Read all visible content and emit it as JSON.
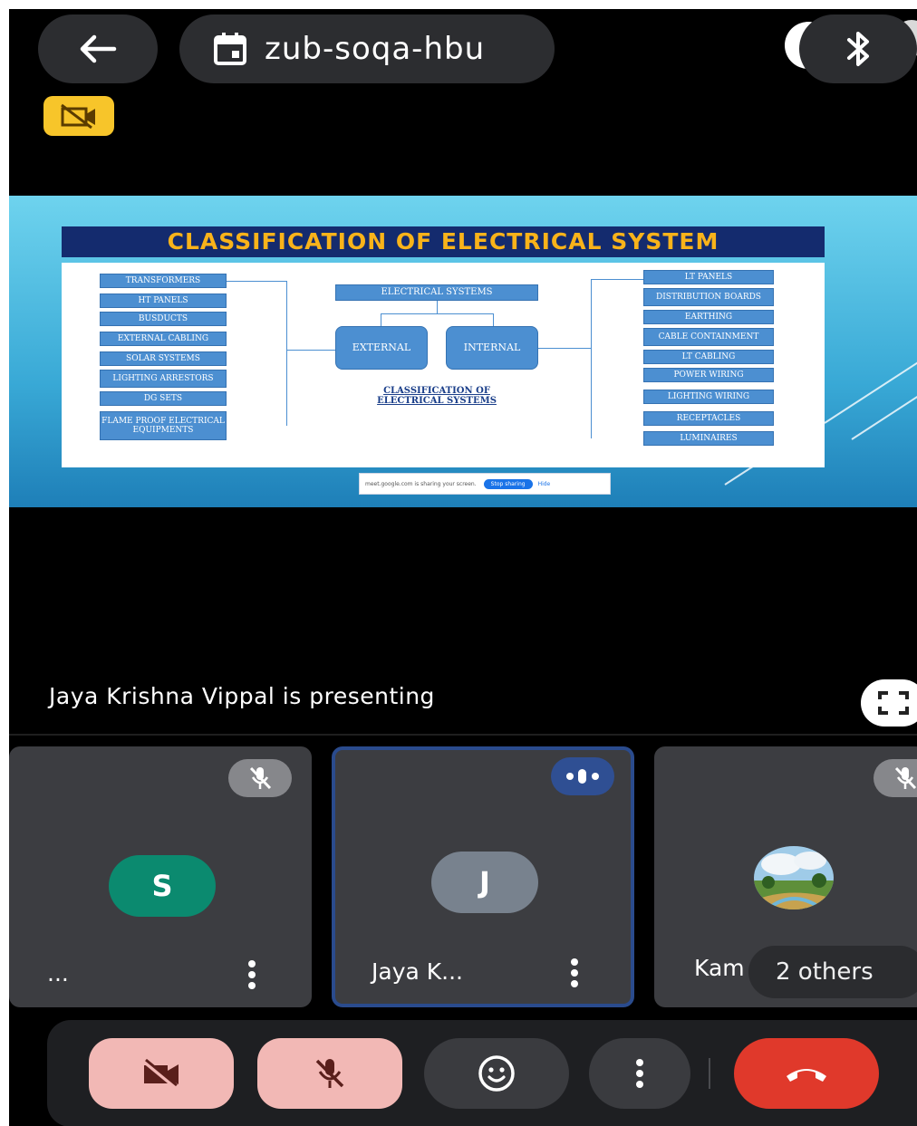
{
  "meeting": {
    "code": "zub-soqa-hbu",
    "presenting_text": "Jaya Krishna Vippal is presenting"
  },
  "slide": {
    "title": "CLASSIFICATION OF ELECTRICAL SYSTEM",
    "center_top": "ELECTRICAL SYSTEMS",
    "external": "EXTERNAL",
    "internal": "INTERNAL",
    "caption_line1": "CLASSIFICATION OF",
    "caption_line2": "ELECTRICAL SYSTEMS",
    "left_items": [
      "TRANSFORMERS",
      "HT PANELS",
      "BUSDUCTS",
      "EXTERNAL CABLING",
      "SOLAR SYSTEMS",
      "LIGHTING ARRESTORS",
      "DG SETS",
      "FLAME PROOF ELECTRICAL EQUIPMENTS"
    ],
    "right_items": [
      "LT PANELS",
      "DISTRIBUTION BOARDS",
      "EARTHING",
      "CABLE CONTAINMENT",
      "LT CABLING",
      "POWER WIRING",
      "LIGHTING WIRING",
      "RECEPTACLES",
      "LUMINAIRES"
    ],
    "share_text": "meet.google.com is sharing your screen.",
    "stop_sharing": "Stop sharing",
    "hide": "Hide"
  },
  "participants": [
    {
      "initial": "S",
      "name": "...",
      "color": "#0b8a6f",
      "status": "muted"
    },
    {
      "initial": "J",
      "name": "Jaya K...",
      "color": "#78828e",
      "status": "speaking"
    },
    {
      "initial": "",
      "name": "Kam",
      "color": "",
      "status": "muted"
    }
  ],
  "others_label": "2 others",
  "colors": {
    "accent_yellow": "#f7c52a",
    "end_call": "#e0392b",
    "muted_control": "#f2b8b5"
  },
  "icons": [
    "back-arrow-icon",
    "calendar-icon",
    "bluetooth-icon",
    "camera-off-icon",
    "mic-off-icon",
    "speaking-icon",
    "fullscreen-icon",
    "emoji-icon",
    "more-vert-icon",
    "end-call-icon"
  ]
}
